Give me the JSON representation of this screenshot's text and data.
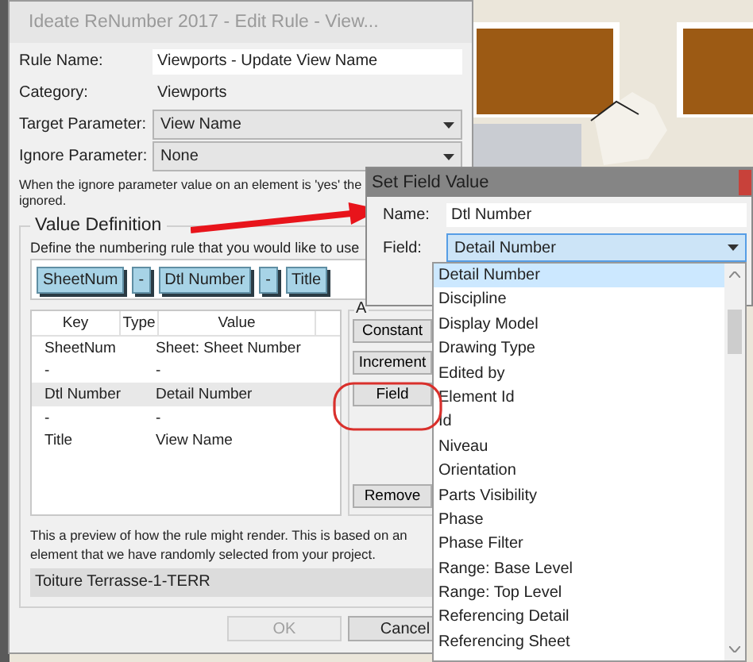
{
  "edit_rule_window": {
    "title": "Ideate ReNumber 2017 - Edit Rule - View...",
    "rule_name": {
      "label": "Rule Name:",
      "value": "Viewports - Update View Name"
    },
    "category": {
      "label": "Category:",
      "value": "Viewports"
    },
    "target_parameter": {
      "label": "Target Parameter:",
      "value": "View Name"
    },
    "ignore_parameter": {
      "label": "Ignore Parameter:",
      "value": "None"
    },
    "note": "When the ignore parameter value on an element is 'yes' the\nignored.",
    "value_definition": {
      "title": "Value Definition",
      "instruction": "Define the numbering rule that you would like to use",
      "tokens": [
        "SheetNum",
        "-",
        "Dtl Number",
        "-",
        "Title"
      ],
      "table": {
        "columns": [
          "Key",
          "Type",
          "Value"
        ],
        "rows": [
          {
            "key": "SheetNum",
            "value": "Sheet: Sheet Number",
            "selected": false
          },
          {
            "key": "-",
            "value": "-",
            "selected": false
          },
          {
            "key": "Dtl Number",
            "value": "Detail Number",
            "selected": true
          },
          {
            "key": "-",
            "value": "-",
            "selected": false
          },
          {
            "key": "Title",
            "value": "View Name",
            "selected": false
          }
        ]
      },
      "add_group": {
        "title": "A",
        "buttons": [
          "Constant",
          "Increment",
          "Field"
        ],
        "remove": "Remove"
      },
      "preview_text": "This a preview of how the rule might render. This is based on an\nelement that we have randomly selected from your project.",
      "preview_value": "Toiture Terrasse-1-TERR"
    },
    "buttons": [
      {
        "label": "OK",
        "disabled": true
      },
      {
        "label": "Cancel",
        "disabled": false
      }
    ]
  },
  "set_field_window": {
    "title": "Set Field Value",
    "name": {
      "label": "Name:",
      "value": "Dtl Number"
    },
    "field": {
      "label": "Field:",
      "value": "Detail Number"
    },
    "options": [
      {
        "label": "Detail Number",
        "selected": true
      },
      {
        "label": "Discipline",
        "selected": false
      },
      {
        "label": "Display Model",
        "selected": false
      },
      {
        "label": "Drawing Type",
        "selected": false
      },
      {
        "label": "Edited by",
        "selected": false
      },
      {
        "label": "Element Id",
        "selected": false
      },
      {
        "label": "Id",
        "selected": false
      },
      {
        "label": "Niveau",
        "selected": false
      },
      {
        "label": "Orientation",
        "selected": false
      },
      {
        "label": "Parts Visibility",
        "selected": false
      },
      {
        "label": "Phase",
        "selected": false
      },
      {
        "label": "Phase Filter",
        "selected": false
      },
      {
        "label": "Range: Base Level",
        "selected": false
      },
      {
        "label": "Range: Top Level",
        "selected": false
      },
      {
        "label": "Referencing Detail",
        "selected": false
      },
      {
        "label": "Referencing Sheet",
        "selected": false
      }
    ]
  }
}
